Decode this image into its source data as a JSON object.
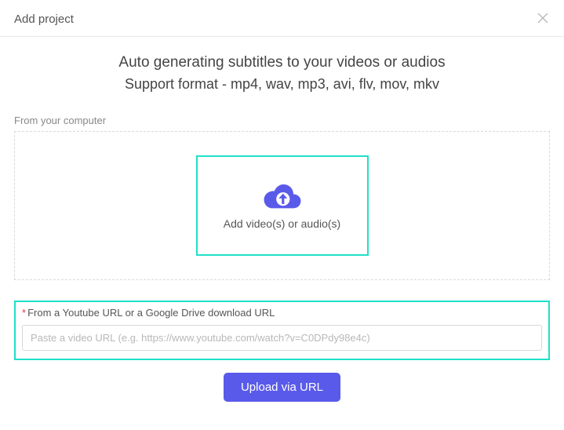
{
  "modal": {
    "title": "Add project"
  },
  "headline": "Auto generating subtitles to your videos or audios",
  "subhead": "Support format - mp4, wav, mp3, avi, flv, mov, mkv",
  "computer_section": {
    "label": "From your computer",
    "drop_text": "Add video(s) or audio(s)"
  },
  "url_section": {
    "label": "From a Youtube URL or a Google Drive download URL",
    "placeholder": "Paste a video URL (e.g. https://www.youtube.com/watch?v=C0DPdy98e4c)",
    "button": "Upload via URL"
  },
  "icons": {
    "close": "close-icon",
    "cloud_upload": "cloud-upload-icon"
  },
  "colors": {
    "accent_teal": "#1fe0c8",
    "primary_purple": "#5a5aea",
    "required_red": "#e63946"
  }
}
